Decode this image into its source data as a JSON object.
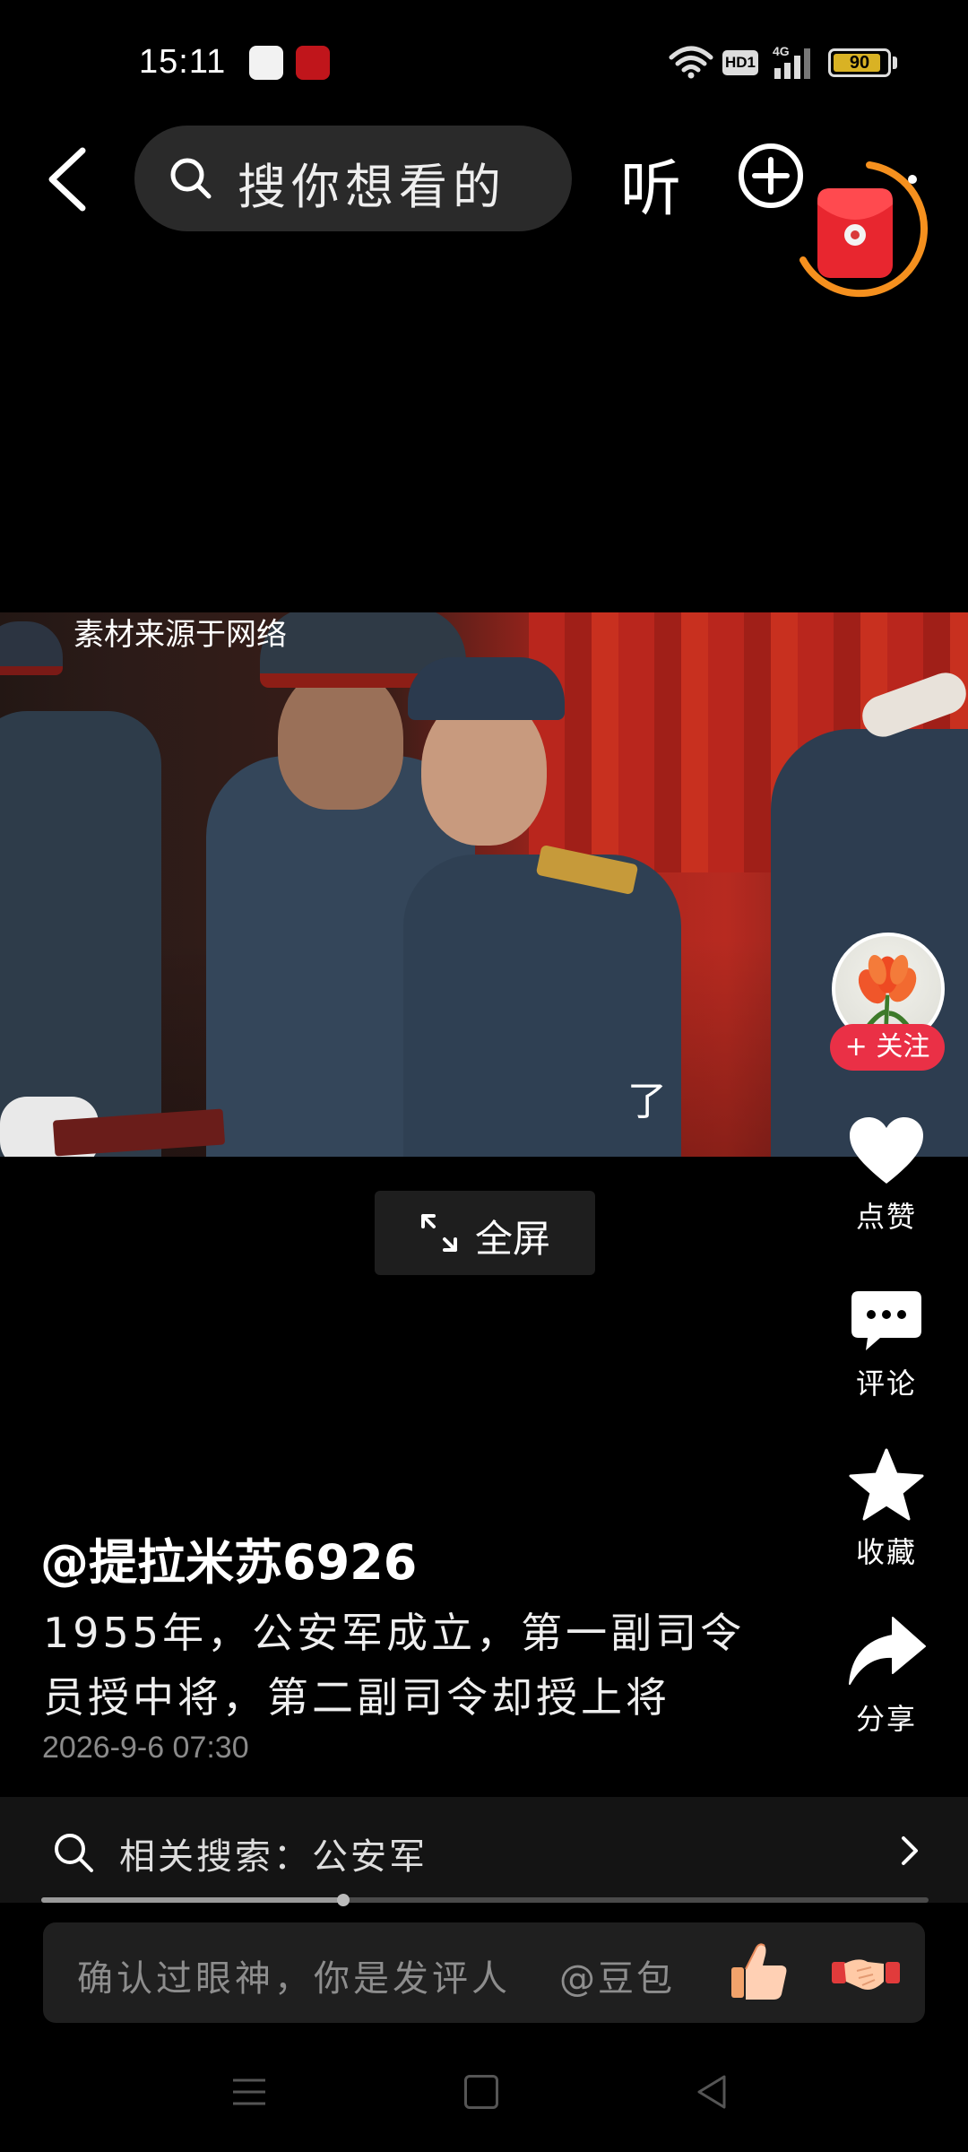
{
  "status_bar": {
    "time": "15:11",
    "hd_label": "HD1",
    "network": "4G",
    "battery": "90",
    "battery_level_pct": 90
  },
  "top_bar": {
    "search_placeholder": "搜你想看的",
    "listen_label": "听"
  },
  "video": {
    "source_note": "素材来源于网络",
    "subtitle": "了",
    "fullscreen_label": "全屏"
  },
  "side_actions": {
    "follow_label": "+ 关注",
    "like_label": "点赞",
    "comment_label": "评论",
    "favorite_label": "收藏",
    "share_label": "分享"
  },
  "post": {
    "author": "@提拉米苏6926",
    "caption_line1": "1955年，公安军成立，第一副司令",
    "caption_line2": "员授中将，第二副司令却授上将",
    "time": "2026-9-6 07:30"
  },
  "related": {
    "label": "相关搜索：公安军"
  },
  "playback": {
    "progress_pct": 34
  },
  "comment": {
    "placeholder": "确认过眼神，你是发评人",
    "mention": "@豆包"
  },
  "colors": {
    "accent_red": "#ea3046",
    "timer_orange": "#f5901e",
    "battery": "#d9b224"
  },
  "icons": [
    "back-icon",
    "search-icon",
    "plus-icon",
    "red-packet-icon",
    "expand-icon",
    "heart-icon",
    "comment-icon",
    "star-icon",
    "share-icon",
    "chevron-right-icon",
    "thumbs-up-emoji",
    "handshake-emoji",
    "nav-menu-icon",
    "nav-home-icon",
    "nav-back-icon"
  ]
}
